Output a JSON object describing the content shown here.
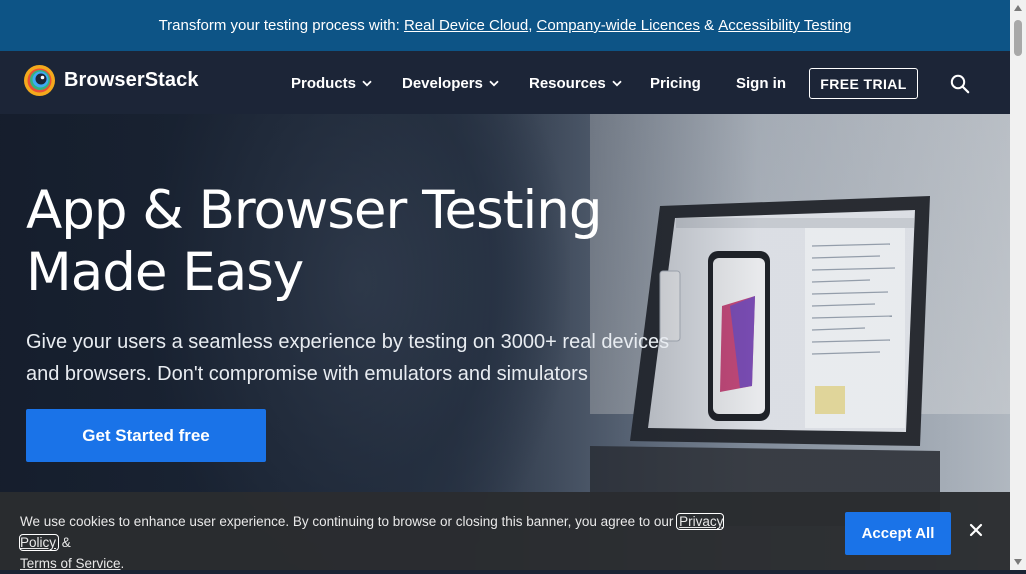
{
  "announcement": {
    "prefix": "Transform your testing process with: ",
    "links": [
      "Real Device Cloud",
      "Company-wide Licences",
      "Accessibility Testing"
    ],
    "sep1": ", ",
    "sep2": " & "
  },
  "brand": {
    "name": "BrowserStack"
  },
  "nav": {
    "items": [
      {
        "label": "Products",
        "icon": "chevron-down-icon"
      },
      {
        "label": "Developers",
        "icon": "chevron-down-icon"
      },
      {
        "label": "Resources",
        "icon": "chevron-down-icon"
      },
      {
        "label": "Pricing"
      },
      {
        "label": "Sign in"
      }
    ],
    "cta": "FREE TRIAL",
    "search_icon": "search-icon"
  },
  "hero": {
    "title_line1": "App & Browser Testing",
    "title_line2": "Made Easy",
    "subtitle": "Give your users a seamless experience by testing on 3000+ real devices and browsers. Don't compromise with emulators and simulators",
    "cta": "Get Started free"
  },
  "cookie": {
    "text": "We use cookies to enhance user experience. By continuing to browse or closing this banner, you agree to our ",
    "privacy": "Privacy Policy",
    "amp": " & ",
    "terms": "Terms of Service",
    "period": ".",
    "accept": "Accept All",
    "close_icon": "close-icon"
  },
  "colors": {
    "announce_bg": "#0d5486",
    "nav_bg": "#1c2537",
    "primary": "#1a73e8",
    "cookie_bg": "#2a2c30"
  }
}
